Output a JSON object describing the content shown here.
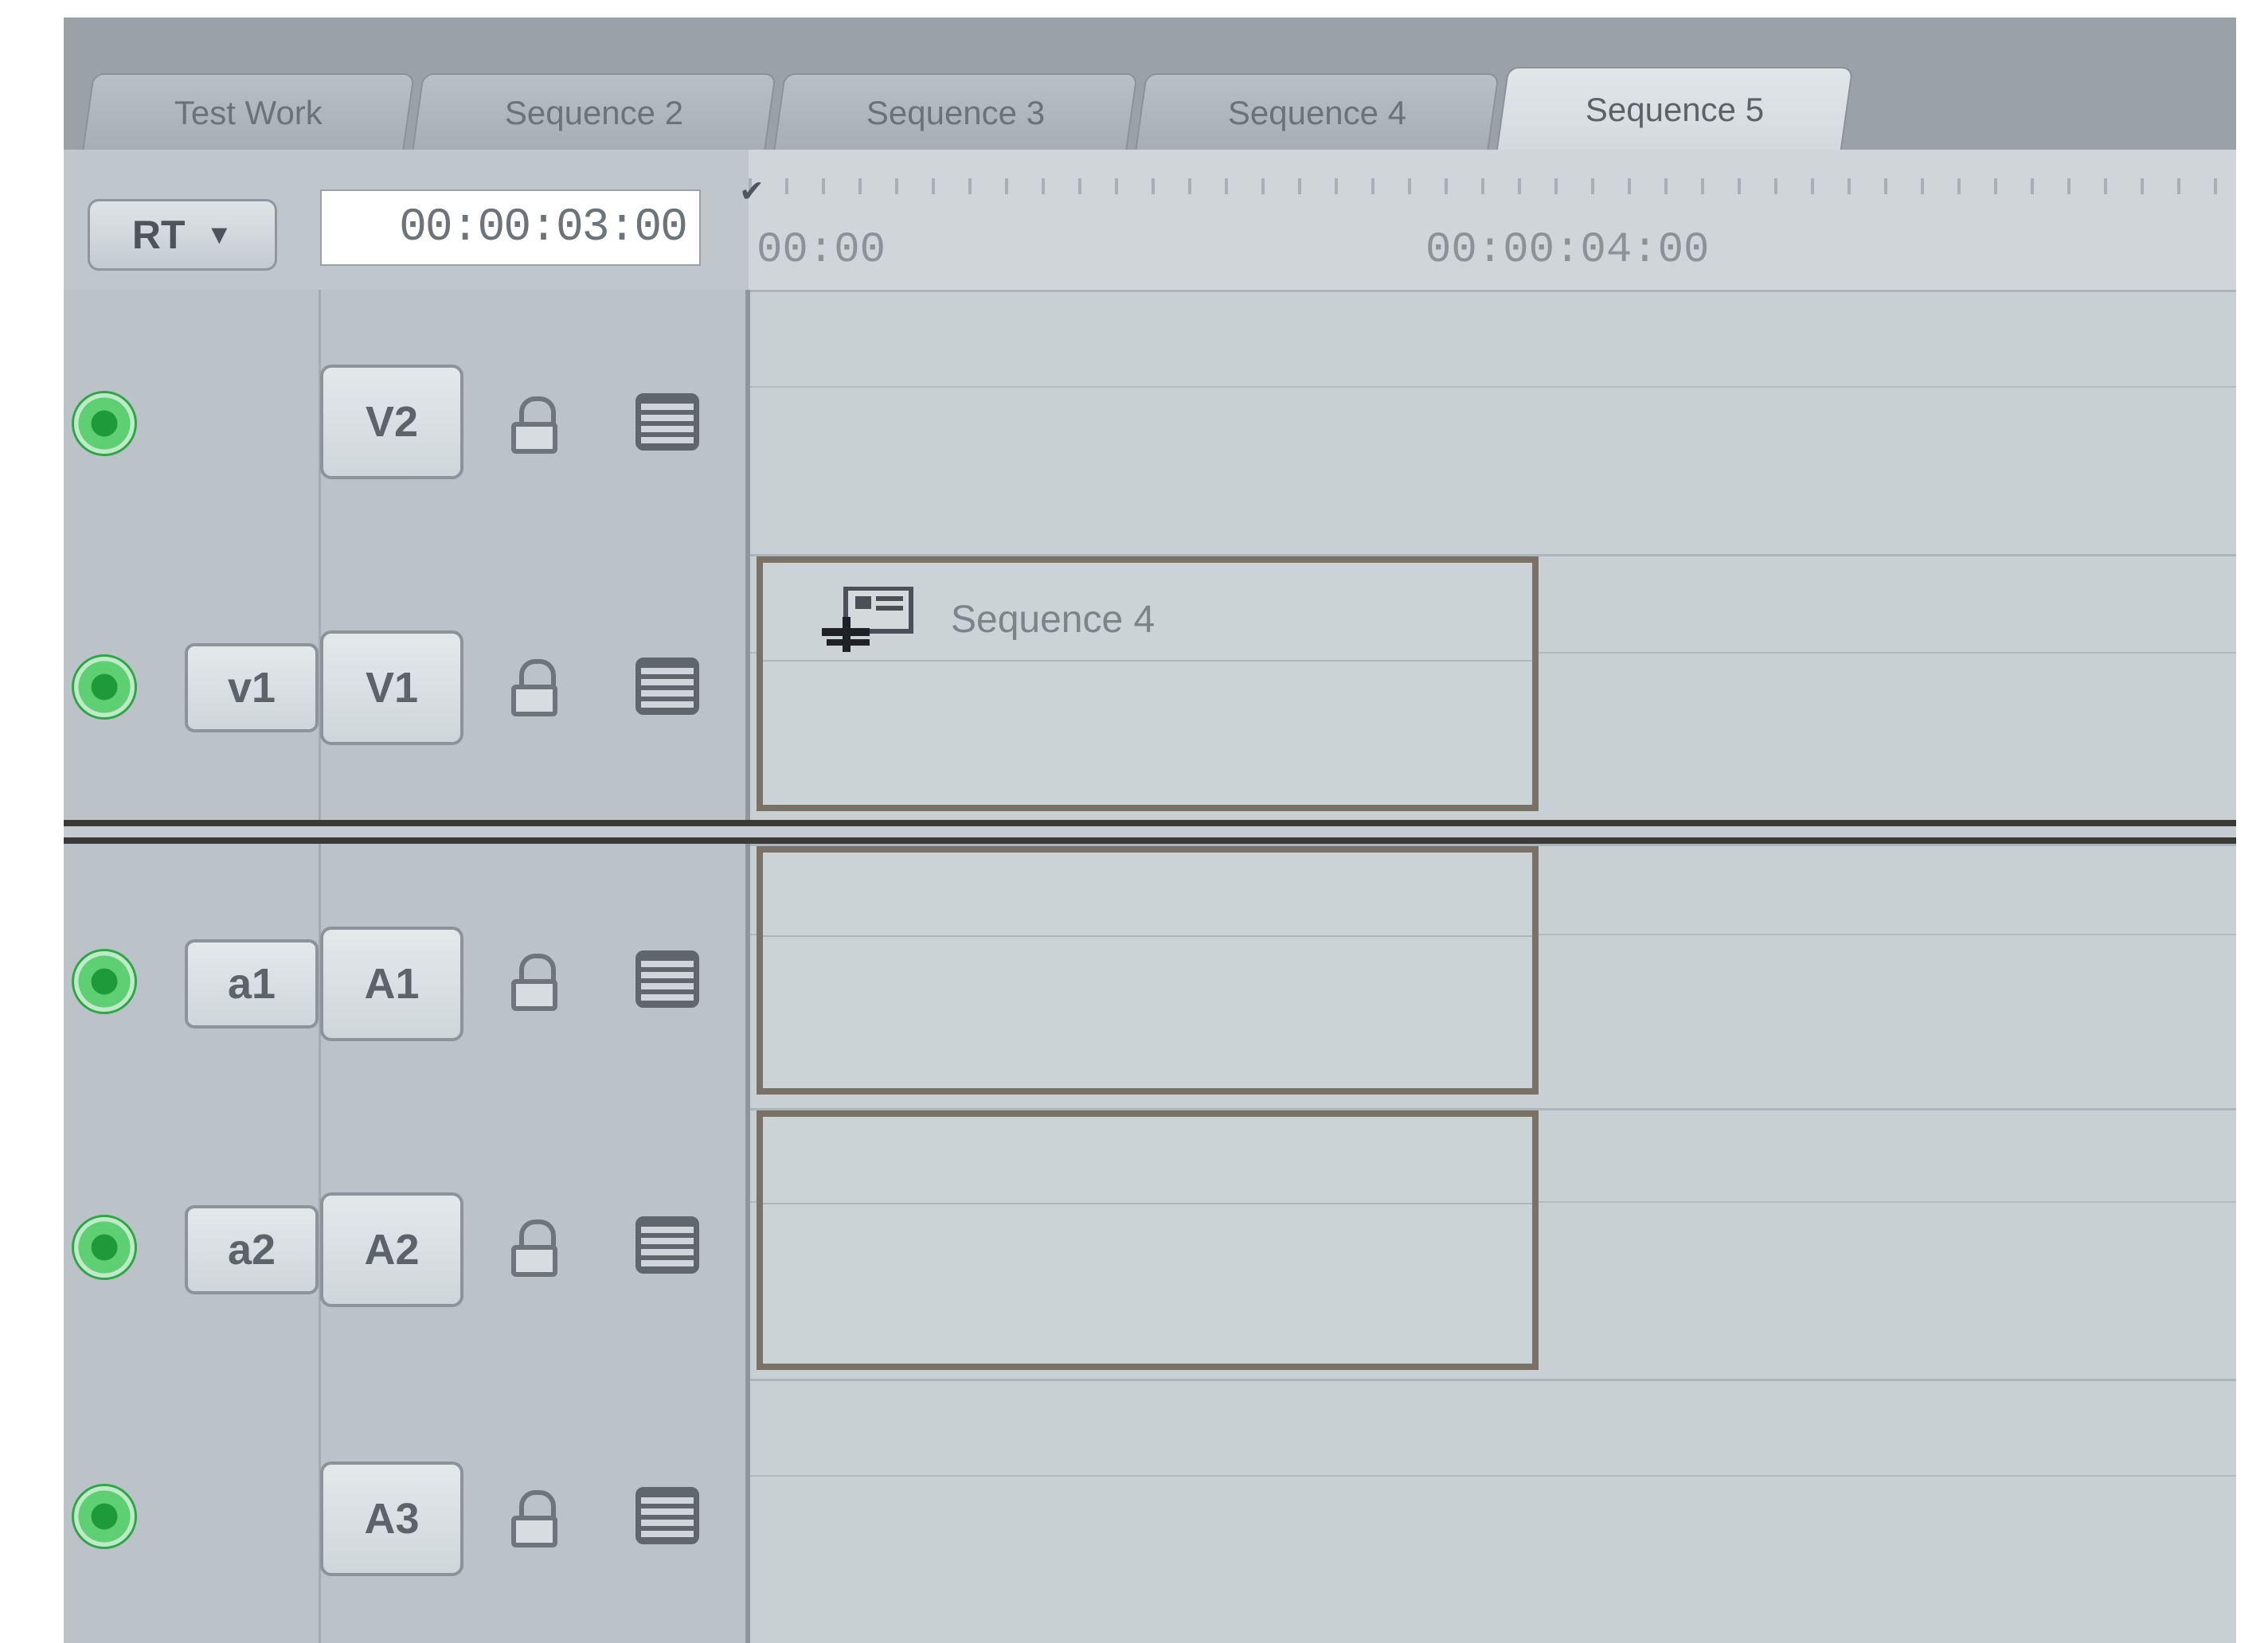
{
  "tabs": [
    {
      "label": "Test Work",
      "active": false
    },
    {
      "label": "Sequence 2",
      "active": false
    },
    {
      "label": "Sequence 3",
      "active": false
    },
    {
      "label": "Sequence 4",
      "active": false
    },
    {
      "label": "Sequence 5",
      "active": true
    }
  ],
  "toolbar": {
    "rt_label": "RT",
    "timecode": "00:00:03:00"
  },
  "ruler": {
    "start_label": "00:00",
    "mark_label": "00:00:04:00"
  },
  "tracks": {
    "v2": {
      "dest_label": "V2"
    },
    "v1": {
      "source_label": "v1",
      "dest_label": "V1"
    },
    "a1": {
      "source_label": "a1",
      "dest_label": "A1"
    },
    "a2": {
      "source_label": "a2",
      "dest_label": "A2"
    },
    "a3": {
      "dest_label": "A3"
    }
  },
  "clips": {
    "v1_name": "Sequence 4"
  },
  "colors": {
    "visibility_on": "#2ea647",
    "clip_border": "#7a7266"
  }
}
